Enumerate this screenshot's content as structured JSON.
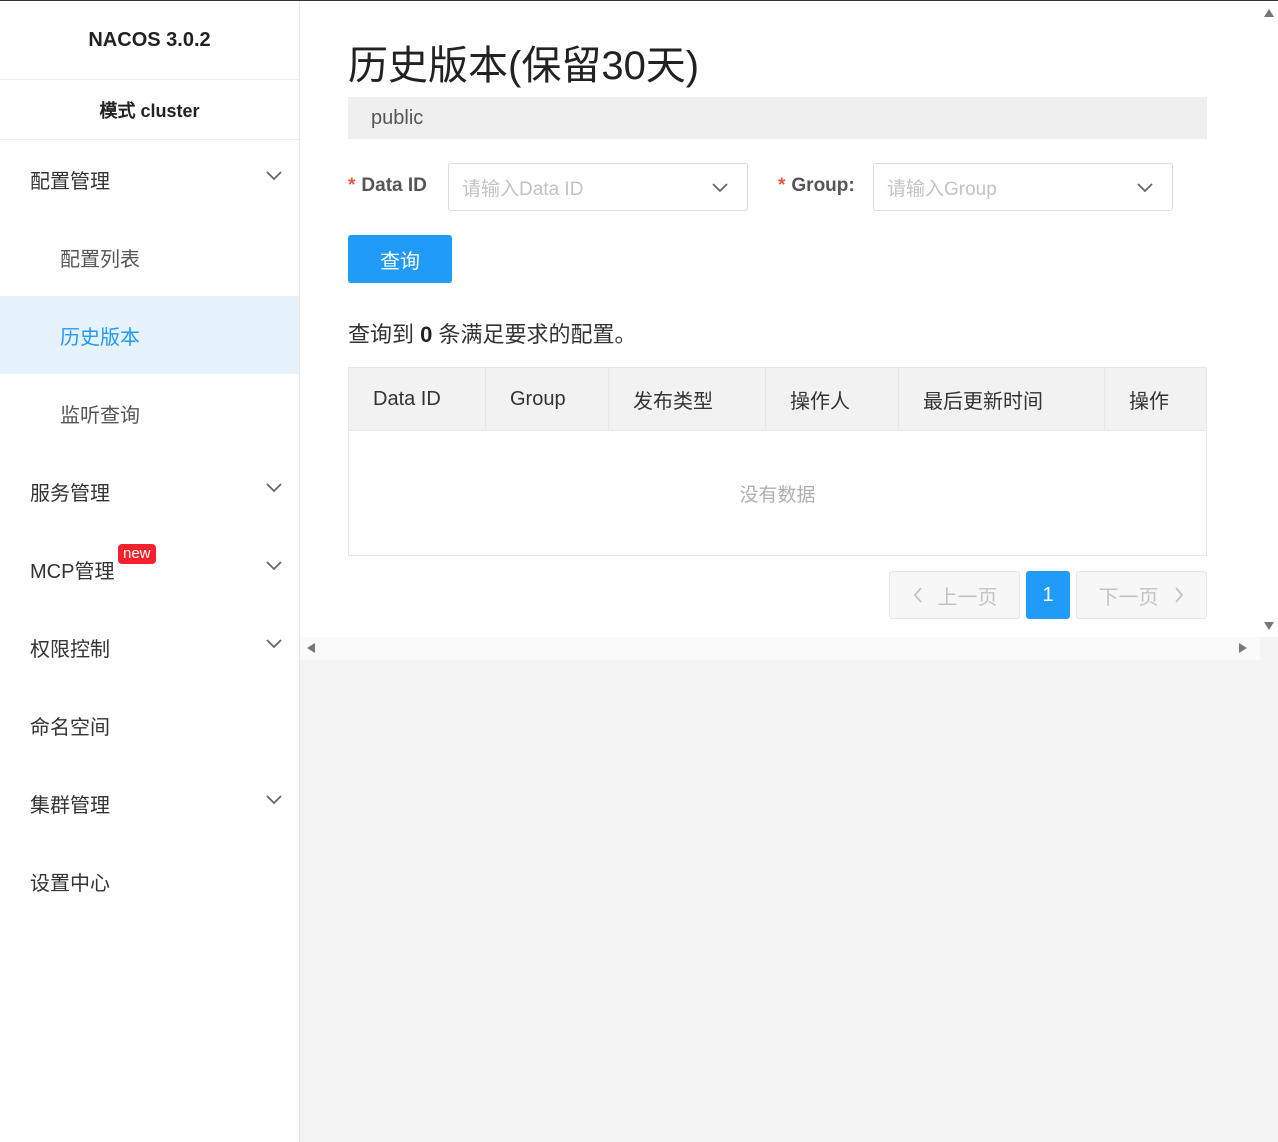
{
  "sidebar": {
    "brand": "NACOS 3.0.2",
    "mode": "模式 cluster",
    "groups": {
      "config": "配置管理",
      "service": "服务管理",
      "mcp": "MCP管理",
      "mcp_badge": "new",
      "auth": "权限控制",
      "namespace": "命名空间",
      "cluster": "集群管理",
      "settings": "设置中心"
    },
    "config_items": {
      "list": "配置列表",
      "history": "历史版本",
      "listen": "监听查询"
    }
  },
  "main": {
    "title": "历史版本(保留30天)",
    "namespace": "public",
    "data_id": {
      "label": "Data ID",
      "placeholder": "请输入Data ID"
    },
    "group": {
      "label": "Group:",
      "placeholder": "请输入Group"
    },
    "query_button": "查询",
    "result": {
      "prefix": "查询到",
      "count": "0",
      "suffix": "条满足要求的配置。"
    },
    "table": {
      "columns": [
        "Data ID",
        "Group",
        "发布类型",
        "操作人",
        "最后更新时间",
        "操作"
      ],
      "empty_text": "没有数据"
    },
    "pagination": {
      "prev": "上一页",
      "page": "1",
      "next": "下一页"
    }
  },
  "colors": {
    "primary": "#209bfa",
    "active_bg": "#e6f2fc",
    "badge": "#f5222d",
    "required": "#e35a3c"
  }
}
